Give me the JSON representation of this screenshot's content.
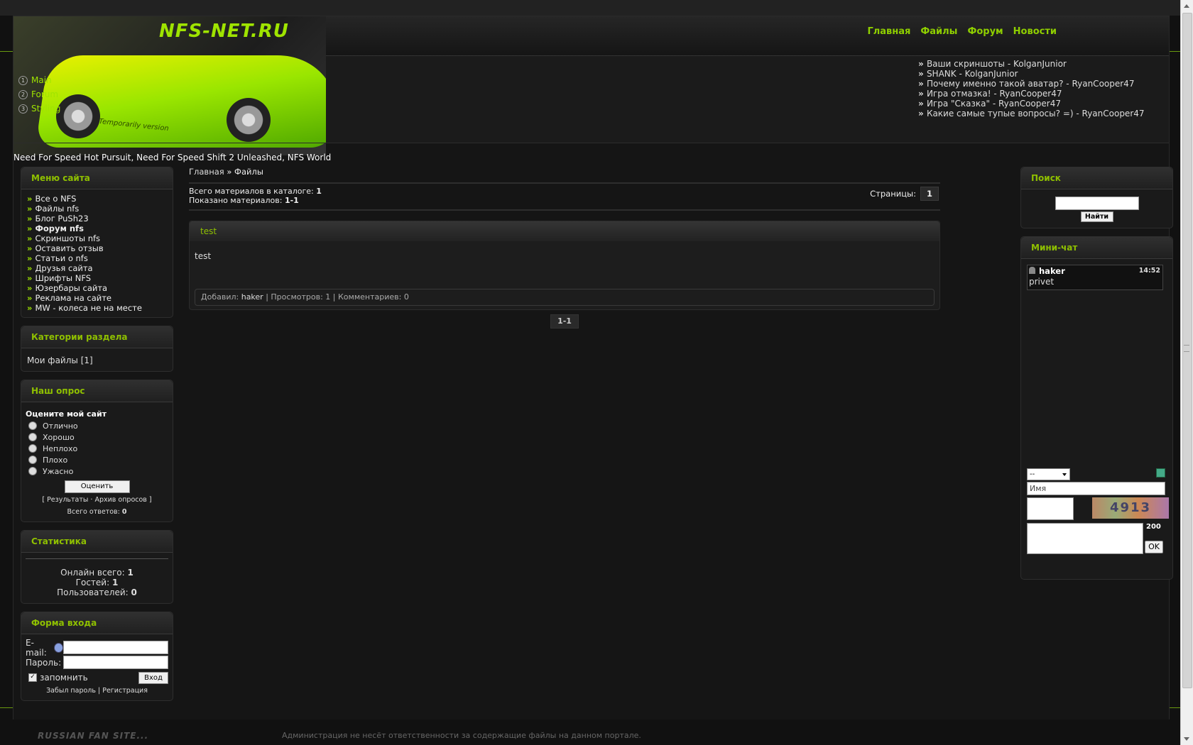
{
  "site": {
    "logo_text": "NFS-NET.RU",
    "logo_subtext": "Temporarily version",
    "tagline": "Need For Speed Hot Pursuit, Need For Speed Shift 2 Unleashed, NFS World"
  },
  "header_menu": [
    {
      "num": "1",
      "label": "Main"
    },
    {
      "num": "2",
      "label": "Forum"
    },
    {
      "num": "3",
      "label": "Styling"
    }
  ],
  "top_nav": [
    "Главная",
    "Файлы",
    "Форум",
    "Новости"
  ],
  "latest_posts": [
    "Ваши скриншоты - KolganJunior",
    "SHANK - KolganJunior",
    "Почему именно такой аватар? - RyanCooper47",
    "Игра отмазка! - RyanCooper47",
    "Игра \"Сказка\" - RyanCooper47",
    "Какие самые тупые вопросы? =) - RyanCooper47"
  ],
  "site_menu": {
    "title": "Меню сайта",
    "items": [
      {
        "label": "Все о NFS"
      },
      {
        "label": "Файлы nfs"
      },
      {
        "label": "Блог PuSh23"
      },
      {
        "label": "Форум nfs"
      },
      {
        "label": "Скриншоты nfs"
      },
      {
        "label": "Оставить отзыв"
      },
      {
        "label": "Статьи о nfs"
      },
      {
        "label": "Друзья сайта"
      },
      {
        "label": "Шрифты NFS"
      },
      {
        "label": "Юзербары сайта"
      },
      {
        "label": "Реклама на сайте"
      },
      {
        "label": "MW - колеса не на месте"
      }
    ]
  },
  "categories": {
    "title": "Категории раздела",
    "item": "Мои файлы",
    "count": "[1]"
  },
  "poll": {
    "title": "Наш опрос",
    "question": "Оцените мой сайт",
    "options": [
      "Отлично",
      "Хорошо",
      "Неплохо",
      "Плохо",
      "Ужасно"
    ],
    "vote_button": "Оценить",
    "results_link": "Результаты",
    "archive_link": "Архив опросов",
    "total_label": "Всего ответов:",
    "total_value": "0"
  },
  "stats": {
    "title": "Статистика",
    "online_label": "Онлайн всего:",
    "online_value": "1",
    "guests_label": "Гостей:",
    "guests_value": "1",
    "users_label": "Пользователей:",
    "users_value": "0"
  },
  "login": {
    "title": "Форма входа",
    "email_label": "E-mail:",
    "password_label": "Пароль:",
    "remember_label": "запомнить",
    "submit": "Вход",
    "forgot_link": "Забыл пароль",
    "register_link": "Регистрация"
  },
  "main": {
    "breadcrumb_home": "Главная",
    "breadcrumb_sep": "»",
    "breadcrumb_current": "Файлы",
    "total_label": "Всего материалов в каталоге:",
    "total_value": "1",
    "shown_label": "Показано материалов:",
    "shown_value": "1-1",
    "pages_label": "Страницы:",
    "page_current": "1",
    "entry": {
      "title": "test",
      "body": "test",
      "added_by_label": "Добавил:",
      "added_by": "haker",
      "views_label": "Просмотров:",
      "views": "1",
      "comments_label": "Комментариев:",
      "comments": "0"
    },
    "pager_bottom": "1-1"
  },
  "search": {
    "title": "Поиск",
    "button": "Найти"
  },
  "minichat": {
    "title": "Мини-чат",
    "message": {
      "user": "haker",
      "time": "14:52",
      "text": "privet"
    },
    "select_value": "--",
    "name_placeholder": "Имя",
    "captcha_text": "4913",
    "char_count": "200",
    "ok_button": "OK"
  },
  "footer": {
    "brand": "RUSSIAN FAN SITE...",
    "disclaimer": "Администрация не несёт ответственности за содержащие файлы на данном портале."
  },
  "colors": {
    "accent": "#8fc000",
    "background": "#151515"
  }
}
